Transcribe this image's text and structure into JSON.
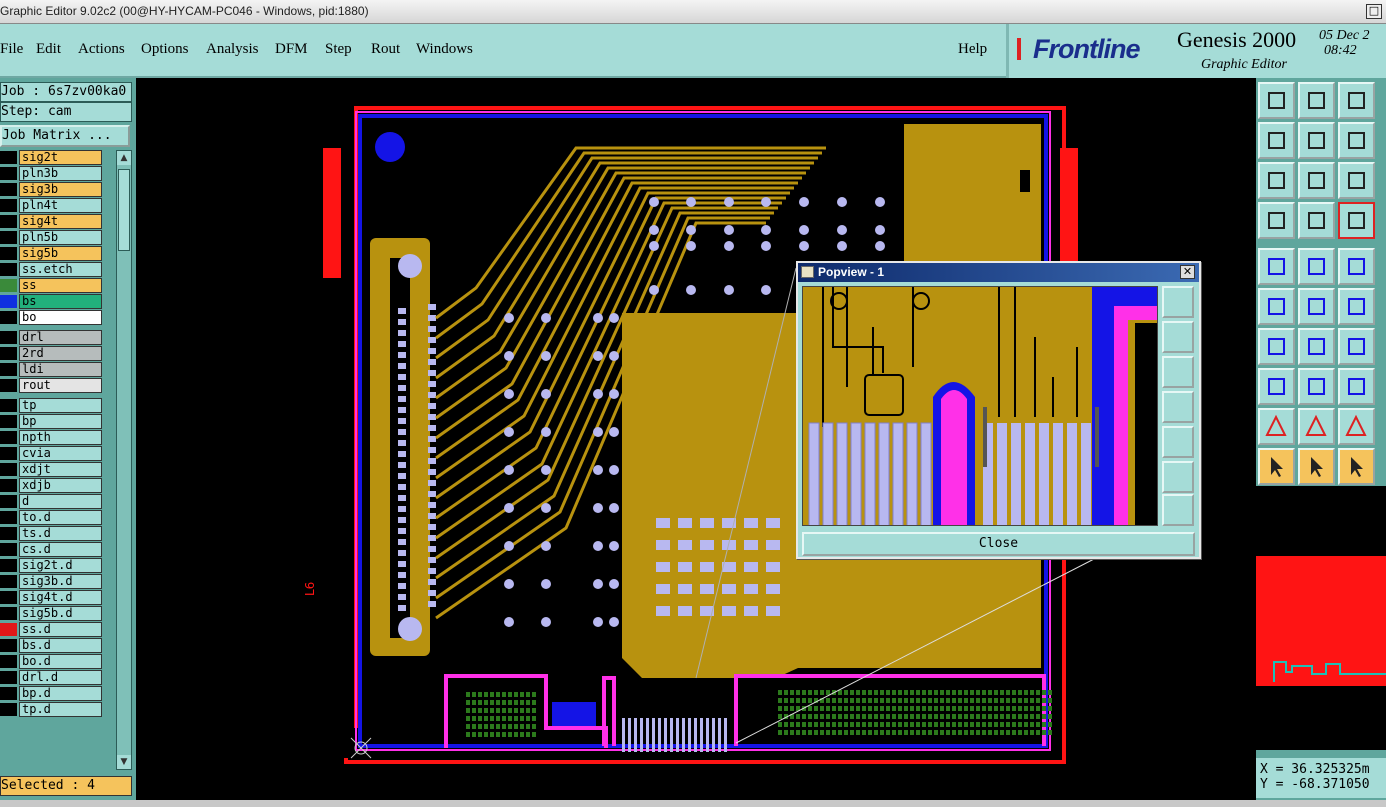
{
  "window": {
    "title": "Graphic Editor 9.02c2 (00@HY-HYCAM-PC046 - Windows, pid:1880)"
  },
  "menu": {
    "file": "File",
    "edit": "Edit",
    "actions": "Actions",
    "options": "Options",
    "analysis": "Analysis",
    "dfm": "DFM",
    "step": "Step",
    "rout": "Rout",
    "windows": "Windows",
    "help": "Help"
  },
  "brand": {
    "logo": "Frontline",
    "product": "Genesis 2000",
    "subtitle": "Graphic Editor",
    "date": "05 Dec 2",
    "time": "08:42"
  },
  "left": {
    "job": "Job : 6s7zv00ka0",
    "step": "Step: cam",
    "matrix_button": "Job Matrix ...",
    "selected_status": "Selected : 4"
  },
  "layers": [
    {
      "name": "sig2t",
      "bg": "#f5c35c",
      "swatch": "#000"
    },
    {
      "name": "pln3b",
      "bg": "#a5dcd7",
      "swatch": "#000"
    },
    {
      "name": "sig3b",
      "bg": "#f5c35c",
      "swatch": "#000"
    },
    {
      "name": "pln4t",
      "bg": "#a5dcd7",
      "swatch": "#000"
    },
    {
      "name": "sig4t",
      "bg": "#f5c35c",
      "swatch": "#000"
    },
    {
      "name": "pln5b",
      "bg": "#a5dcd7",
      "swatch": "#000"
    },
    {
      "name": "sig5b",
      "bg": "#f5c35c",
      "swatch": "#000"
    },
    {
      "name": "ss.etch",
      "bg": "#a5dcd7",
      "swatch": "#000"
    },
    {
      "name": "ss",
      "bg": "#f5c35c",
      "swatch": "#3a8a3a"
    },
    {
      "name": "bs",
      "bg": "#22b07c",
      "swatch": "#1030e0"
    },
    {
      "name": "bo",
      "bg": "#ffffff",
      "swatch": "#000"
    },
    {
      "name": "drl",
      "bg": "#b6bcbc",
      "swatch": "#000"
    },
    {
      "name": "2rd",
      "bg": "#b6bcbc",
      "swatch": "#000"
    },
    {
      "name": "ldi",
      "bg": "#b6bcbc",
      "swatch": "#000"
    },
    {
      "name": "rout",
      "bg": "#e4e4e4",
      "swatch": "#000"
    },
    {
      "name": "tp",
      "bg": "#a5dcd7",
      "swatch": "#000"
    },
    {
      "name": "bp",
      "bg": "#a5dcd7",
      "swatch": "#000"
    },
    {
      "name": "npth",
      "bg": "#a5dcd7",
      "swatch": "#000"
    },
    {
      "name": "cvia",
      "bg": "#a5dcd7",
      "swatch": "#000"
    },
    {
      "name": "xdjt",
      "bg": "#a5dcd7",
      "swatch": "#000"
    },
    {
      "name": "xdjb",
      "bg": "#a5dcd7",
      "swatch": "#000"
    },
    {
      "name": "d",
      "bg": "#a5dcd7",
      "swatch": "#000"
    },
    {
      "name": "to.d",
      "bg": "#a5dcd7",
      "swatch": "#000"
    },
    {
      "name": "ts.d",
      "bg": "#a5dcd7",
      "swatch": "#000"
    },
    {
      "name": "cs.d",
      "bg": "#a5dcd7",
      "swatch": "#000"
    },
    {
      "name": "sig2t.d",
      "bg": "#a5dcd7",
      "swatch": "#000"
    },
    {
      "name": "sig3b.d",
      "bg": "#a5dcd7",
      "swatch": "#000"
    },
    {
      "name": "sig4t.d",
      "bg": "#a5dcd7",
      "swatch": "#000"
    },
    {
      "name": "sig5b.d",
      "bg": "#a5dcd7",
      "swatch": "#000"
    },
    {
      "name": "ss.d",
      "bg": "#a5dcd7",
      "swatch": "#e01818"
    },
    {
      "name": "bs.d",
      "bg": "#a5dcd7",
      "swatch": "#000"
    },
    {
      "name": "bo.d",
      "bg": "#a5dcd7",
      "swatch": "#000"
    },
    {
      "name": "drl.d",
      "bg": "#a5dcd7",
      "swatch": "#000"
    },
    {
      "name": "bp.d",
      "bg": "#a5dcd7",
      "swatch": "#000"
    },
    {
      "name": "tp.d",
      "bg": "#a5dcd7",
      "swatch": "#000"
    }
  ],
  "canvas": {
    "side_label": "L6"
  },
  "popview": {
    "title": "Popview - 1",
    "close_label": "Close"
  },
  "coords": {
    "x": "X = 36.325325m",
    "y": "Y = -68.371050"
  },
  "colors": {
    "panel": "#a5dcd7",
    "panel_dark": "#5fa69d",
    "copper": "#b8920f",
    "mask_blue": "#1414e6",
    "outline_red": "#ff1414",
    "pad_lavender": "#b8b8f0",
    "magenta": "#ff30e8",
    "highlight": "#f5c35c"
  }
}
